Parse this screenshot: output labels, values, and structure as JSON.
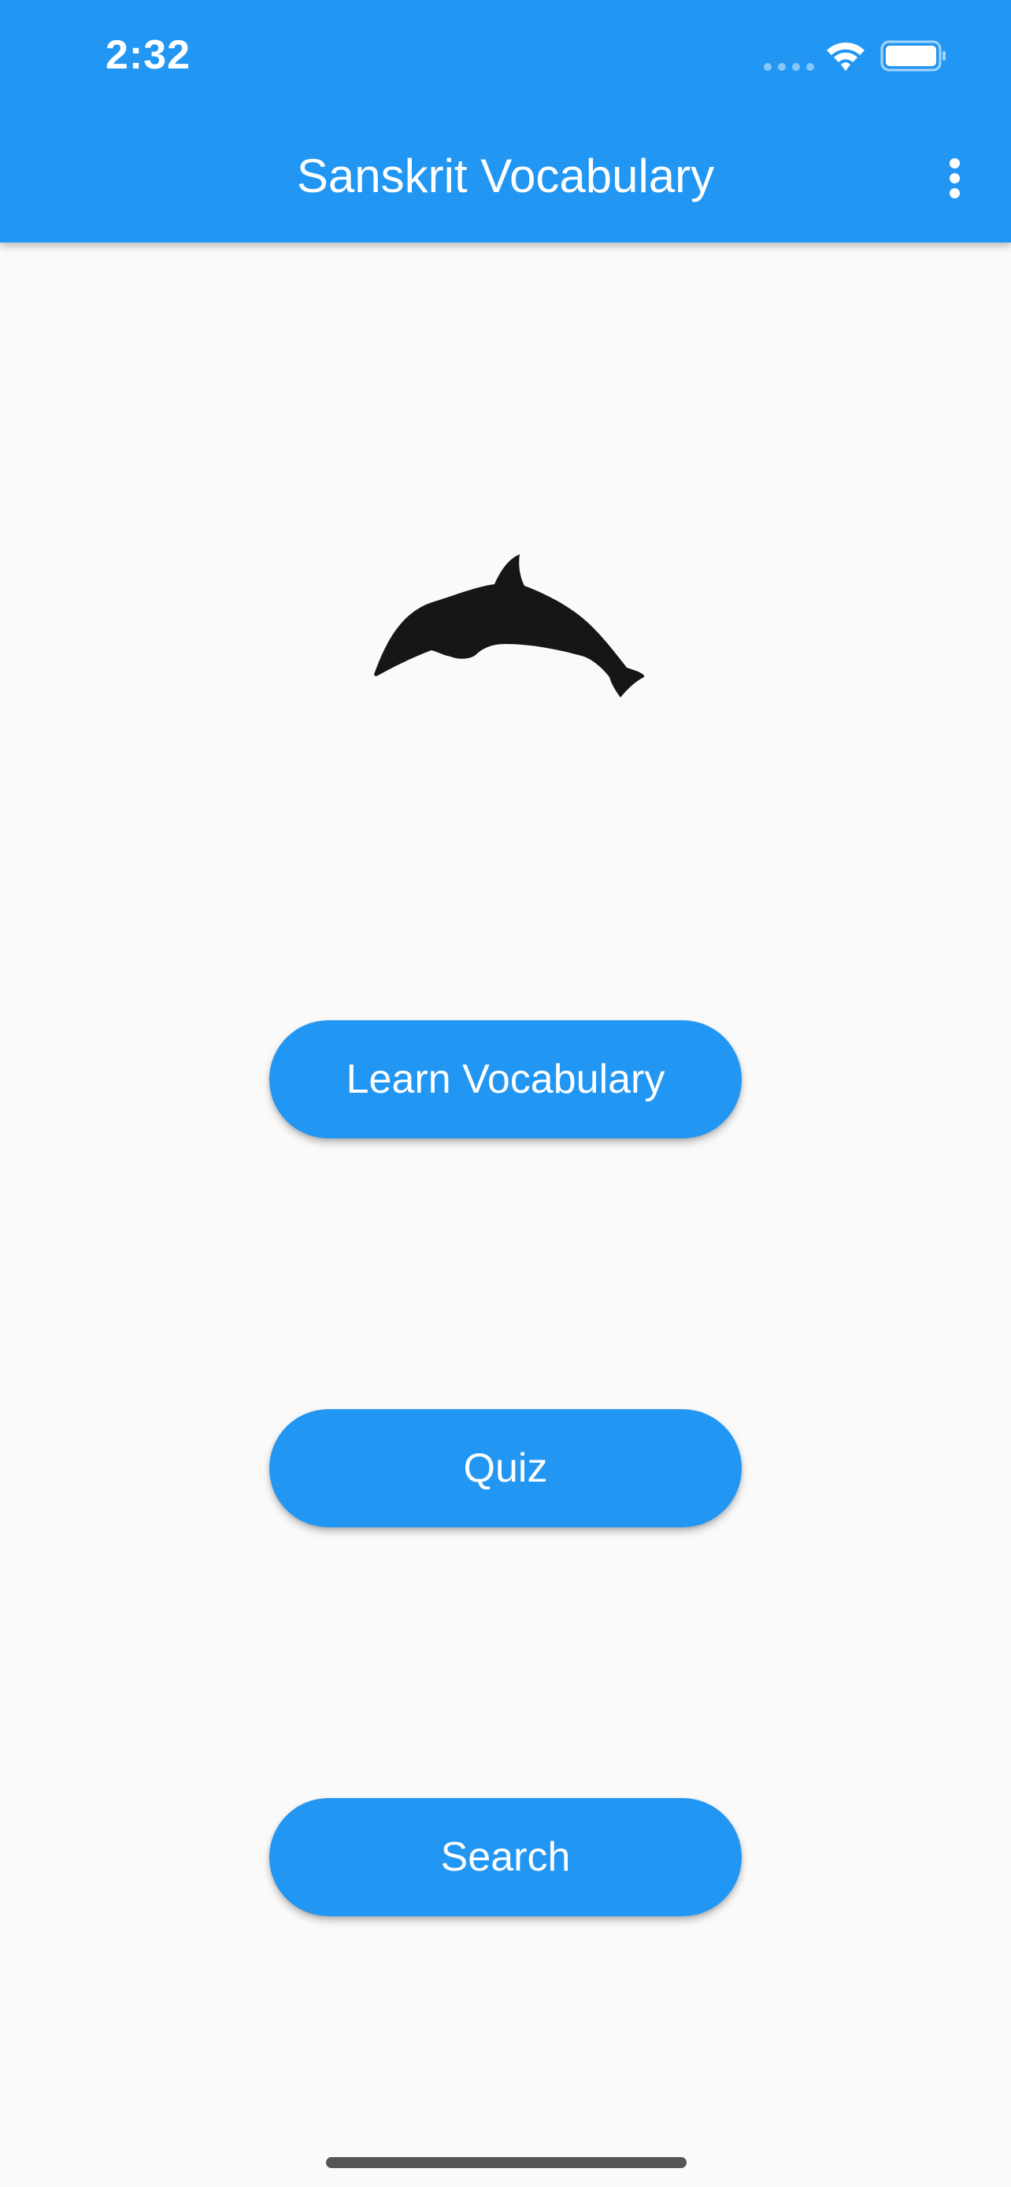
{
  "status_bar": {
    "time": "2:32",
    "icons": [
      "cellular-signal-icon",
      "wifi-icon",
      "battery-icon"
    ]
  },
  "app_bar": {
    "title": "Sanskrit Vocabulary",
    "menu_icon": "more-vertical-icon",
    "background_color": "#2196f3"
  },
  "hero": {
    "icon": "dolphin-icon"
  },
  "buttons": {
    "learn_label": "Learn Vocabulary",
    "quiz_label": "Quiz",
    "search_label": "Search",
    "color": "#2196f3"
  }
}
